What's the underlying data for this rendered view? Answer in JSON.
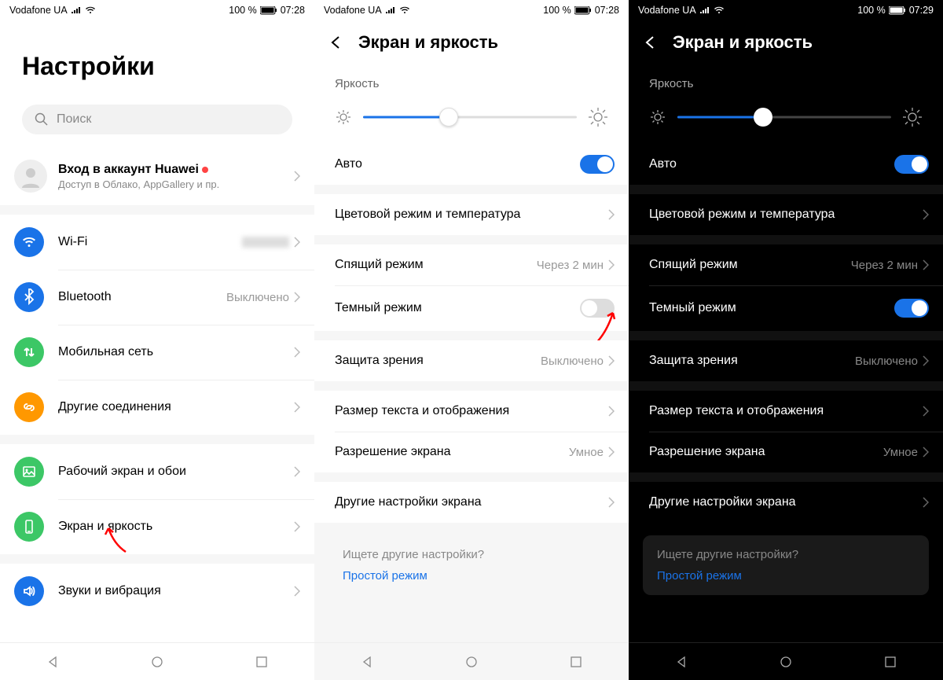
{
  "statusbar": {
    "carrier": "Vodafone UA",
    "battery": "100 %",
    "time1": "07:28",
    "time2": "07:29"
  },
  "screen1": {
    "title": "Настройки",
    "search_placeholder": "Поиск",
    "account": {
      "title": "Вход в аккаунт Huawei",
      "sub": "Доступ в Облако, AppGallery и пр."
    },
    "items": {
      "wifi": "Wi-Fi",
      "bluetooth": {
        "label": "Bluetooth",
        "value": "Выключено"
      },
      "mobile": "Мобильная сеть",
      "other_conn": "Другие соединения",
      "home_wall": "Рабочий экран и обои",
      "display": "Экран и яркость",
      "sound": "Звуки и вибрация"
    }
  },
  "screen2": {
    "title": "Экран и яркость",
    "brightness_label": "Яркость",
    "brightness_percent": 40,
    "auto": "Авто",
    "items": {
      "color": "Цветовой режим и температура",
      "sleep": {
        "label": "Спящий режим",
        "value": "Через 2 мин"
      },
      "dark": "Темный режим",
      "eye": {
        "label": "Защита зрения",
        "value": "Выключено"
      },
      "textsize": "Размер текста и отображения",
      "resolution": {
        "label": "Разрешение экрана",
        "value": "Умное"
      },
      "other": "Другие настройки экрана"
    },
    "hint": {
      "q": "Ищете другие настройки?",
      "link": "Простой режим"
    }
  },
  "colors": {
    "wifi": "#1a73e8",
    "bt": "#1a73e8",
    "mobile": "#3cc766",
    "link": "#ff9800",
    "home": "#3cc766",
    "display": "#3cc766",
    "sound": "#1a73e8"
  }
}
